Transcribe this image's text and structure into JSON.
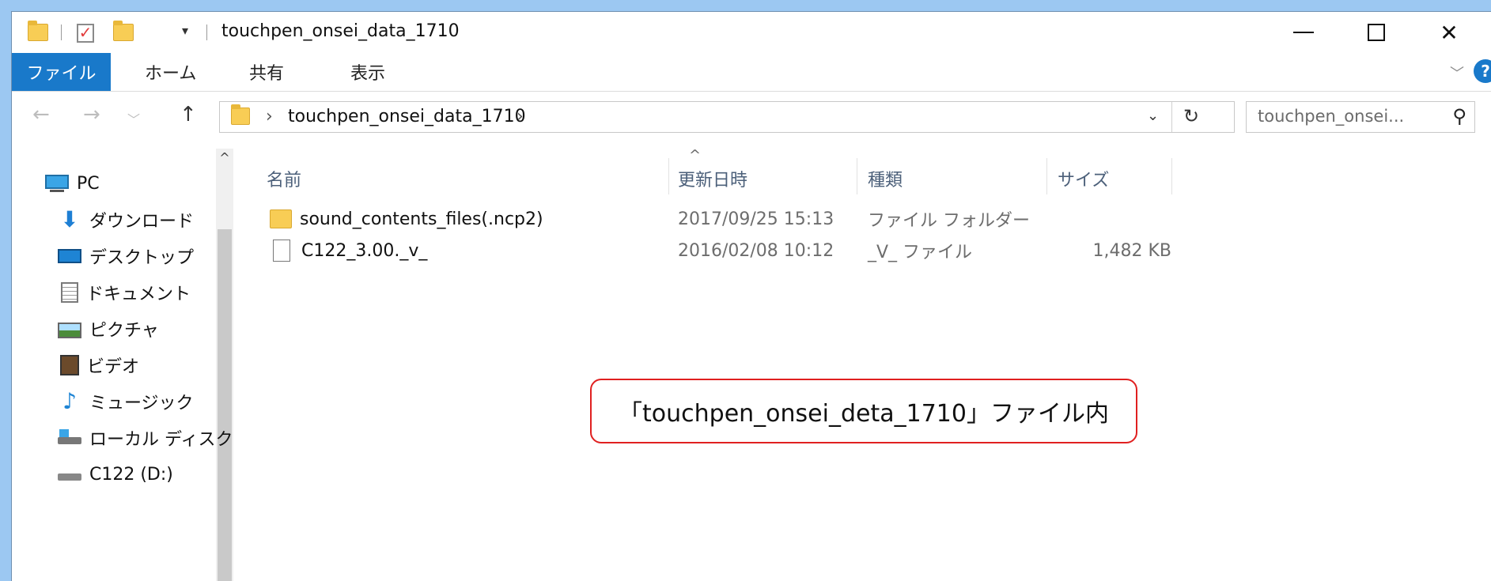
{
  "window": {
    "title": "touchpen_onsei_data_1710",
    "quick_access_dropdown": "▾",
    "minimize": "minimize",
    "maximize": "maximize",
    "close": "✕"
  },
  "ribbon": {
    "tabs": [
      {
        "label": "ファイル",
        "active": true
      },
      {
        "label": "ホーム"
      },
      {
        "label": "共有"
      },
      {
        "label": "表示"
      }
    ],
    "help": "?"
  },
  "address": {
    "path": "touchpen_onsei_data_1710",
    "search_placeholder": "touchpen_onsei..."
  },
  "nav_pane": {
    "items": [
      {
        "label": "PC",
        "icon": "pc-icon"
      },
      {
        "label": "ダウンロード",
        "icon": "download-icon"
      },
      {
        "label": "デスクトップ",
        "icon": "desktop-icon"
      },
      {
        "label": "ドキュメント",
        "icon": "documents-icon"
      },
      {
        "label": "ピクチャ",
        "icon": "pictures-icon"
      },
      {
        "label": "ビデオ",
        "icon": "videos-icon"
      },
      {
        "label": "ミュージック",
        "icon": "music-icon"
      },
      {
        "label": "ローカル ディスク",
        "icon": "local-disk-icon"
      },
      {
        "label": "C122 (D:)",
        "icon": "drive-icon"
      }
    ]
  },
  "file_list": {
    "columns": [
      "名前",
      "更新日時",
      "種類",
      "サイズ"
    ],
    "rows": [
      {
        "name": "sound_contents_files(.ncp2)",
        "modified": "2017/09/25 15:13",
        "type": "ファイル フォルダー",
        "size": "",
        "icon": "folder-icon"
      },
      {
        "name": "C122_3.00._v_",
        "modified": "2016/02/08 10:12",
        "type": "_V_ ファイル",
        "size": "1,482 KB",
        "icon": "file-icon"
      }
    ]
  },
  "callout": {
    "text": "「touchpen_onsei_deta_1710」ファイル内"
  },
  "colors": {
    "accent": "#1979ca",
    "background": "#9cc8f2",
    "callout_border": "#e02020"
  }
}
